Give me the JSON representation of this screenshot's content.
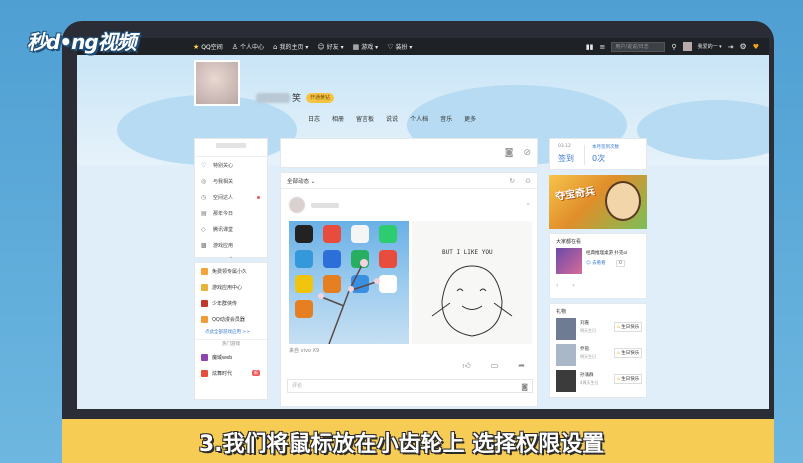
{
  "watermark": {
    "logo_text": "秒d•ng视频"
  },
  "caption": "3.我们将鼠标放在小齿轮上 选择权限设置",
  "topbar": {
    "brand_name": "QQ空间",
    "items": [
      {
        "icon": "user-icon",
        "glyph": "♙",
        "label": "个人中心"
      },
      {
        "icon": "home-icon",
        "glyph": "⌂",
        "label": "我的主页 ▾"
      },
      {
        "icon": "friends-icon",
        "glyph": "☺",
        "label": "好友 ▾"
      },
      {
        "icon": "apps-grid-icon",
        "glyph": "▦",
        "label": "游戏 ▾"
      },
      {
        "icon": "gift-icon",
        "glyph": "♡",
        "label": "装扮 ▾"
      }
    ],
    "search_placeholder": "用户/说说/日志",
    "user_label": "我爱的一 ▾"
  },
  "profile": {
    "name_visible_char": "笑",
    "vip_label": "开通黄钻"
  },
  "nav_tabs": [
    "日志",
    "相册",
    "留言板",
    "说说",
    "个人档",
    "音乐",
    "更多"
  ],
  "left_menu": {
    "items": [
      {
        "icon": "heart-icon",
        "glyph": "♡",
        "label": "特别关心"
      },
      {
        "icon": "circle-icon",
        "glyph": "◎",
        "label": "与我相关"
      },
      {
        "icon": "clock-icon",
        "glyph": "◷",
        "label": "空间达人",
        "dot": true
      },
      {
        "icon": "calendar-icon",
        "glyph": "▤",
        "label": "那年今日"
      },
      {
        "icon": "book-icon",
        "glyph": "◇",
        "label": "腾讯课堂"
      },
      {
        "icon": "gamepad-icon",
        "glyph": "▩",
        "label": "游戏应用"
      }
    ],
    "collapse": "⌄"
  },
  "app_menu": {
    "items": [
      {
        "label": "免费领专属小久",
        "color": "#f2a33a"
      },
      {
        "label": "游戏应用中心",
        "color": "#e8b33a"
      },
      {
        "label": "少年群侠传",
        "color": "#c0392b"
      },
      {
        "label": "QQ动漫会员器",
        "color": "#f29b38"
      }
    ],
    "more_link": "点此全部游戏应用 >>",
    "hot_games_label": "热门游戏",
    "games": [
      {
        "label": "魔域web",
        "color": "#8e44ad"
      },
      {
        "label": "炫舞时代",
        "color": "#e74c3c",
        "badge": "新"
      }
    ]
  },
  "feed": {
    "filter_label": "全部动态 ⌄",
    "source_text": "来自 vivo X9",
    "comment_placeholder": "评论",
    "photo2_text": "BUT I LIKE YOU"
  },
  "sign": {
    "date": "03.12",
    "label": "签到",
    "total_label": "本月签到次数",
    "count": "0次"
  },
  "game_banner": {
    "text": "夺宝奇兵"
  },
  "game_panel": {
    "title": "大家都在看",
    "item_name": "经典推理桌游 扑克ol",
    "follow_label": "☺ 去看看",
    "count": "0",
    "nav": "‹ ›"
  },
  "gifts": {
    "title": "礼物",
    "rows": [
      {
        "name": "刘嘉",
        "date": "明天生日",
        "button": "生日快乐",
        "color": "#6f7b92"
      },
      {
        "name": "乔茵",
        "date": "明天生日",
        "button": "生日快乐",
        "color": "#a9b7c9"
      },
      {
        "name": "孙涌群",
        "date": "4周天生日",
        "button": "生日快乐",
        "color": "#3b3b3b"
      }
    ]
  },
  "colors": {
    "topbar": "#1e2226",
    "accent_blue": "#3a7bd5",
    "caption_bar": "#f7cc55",
    "vip_gold": "#f5c443"
  }
}
